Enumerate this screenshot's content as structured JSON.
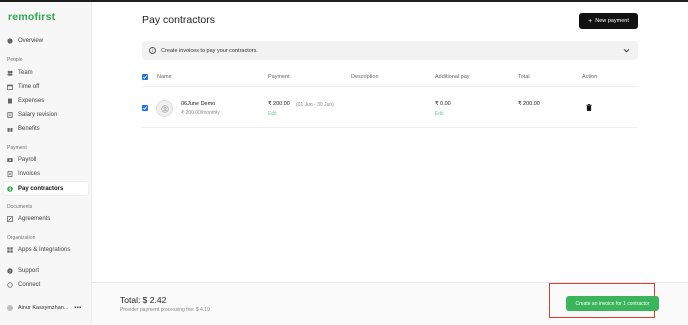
{
  "app": {
    "logo": "remofirst"
  },
  "sidebar": {
    "overview": "Overview",
    "sections": {
      "people": "People",
      "payment": "Payment",
      "documents": "Documents",
      "organization": "Organization"
    },
    "people_items": [
      "Team",
      "Time off",
      "Expenses",
      "Salary revision",
      "Benefits"
    ],
    "payment_items": [
      "Payroll",
      "Invoices",
      "Pay contractors"
    ],
    "documents_items": [
      "Agreements"
    ],
    "organization_items": [
      "Apps & Integrations"
    ],
    "bottom_items": [
      "Support",
      "Connect"
    ],
    "user_name": "Ainur Kassymzhan...",
    "user_more": "•••"
  },
  "page": {
    "title": "Pay contractors",
    "new_payment_label": "New payment",
    "info_text": "Create invoices to pay your contractors."
  },
  "table": {
    "headers": {
      "name": "Name",
      "payment": "Payment",
      "description": "Description",
      "additional_pay": "Additional pay",
      "total": "Total",
      "action": "Action"
    },
    "rows": [
      {
        "name": "06June Demo",
        "rate": "₹ 200.00/monthly",
        "payment": "₹ 200.00",
        "period": "(01 Jun - 30 Jun)",
        "payment_edit": "Edit",
        "additional_pay": "₹ 0.00",
        "additional_edit": "Edit",
        "total": "₹ 200.00"
      }
    ]
  },
  "footer": {
    "total": "Total: $ 2.42",
    "fee": "Provider payment processing fee: $ 4.19",
    "create_label": "Create an invoice for 1 contractor"
  },
  "colors": {
    "accent": "#3bb55c",
    "brand": "#2fa84f",
    "highlight": "#e03b2f",
    "checkbox": "#1a73e8"
  }
}
